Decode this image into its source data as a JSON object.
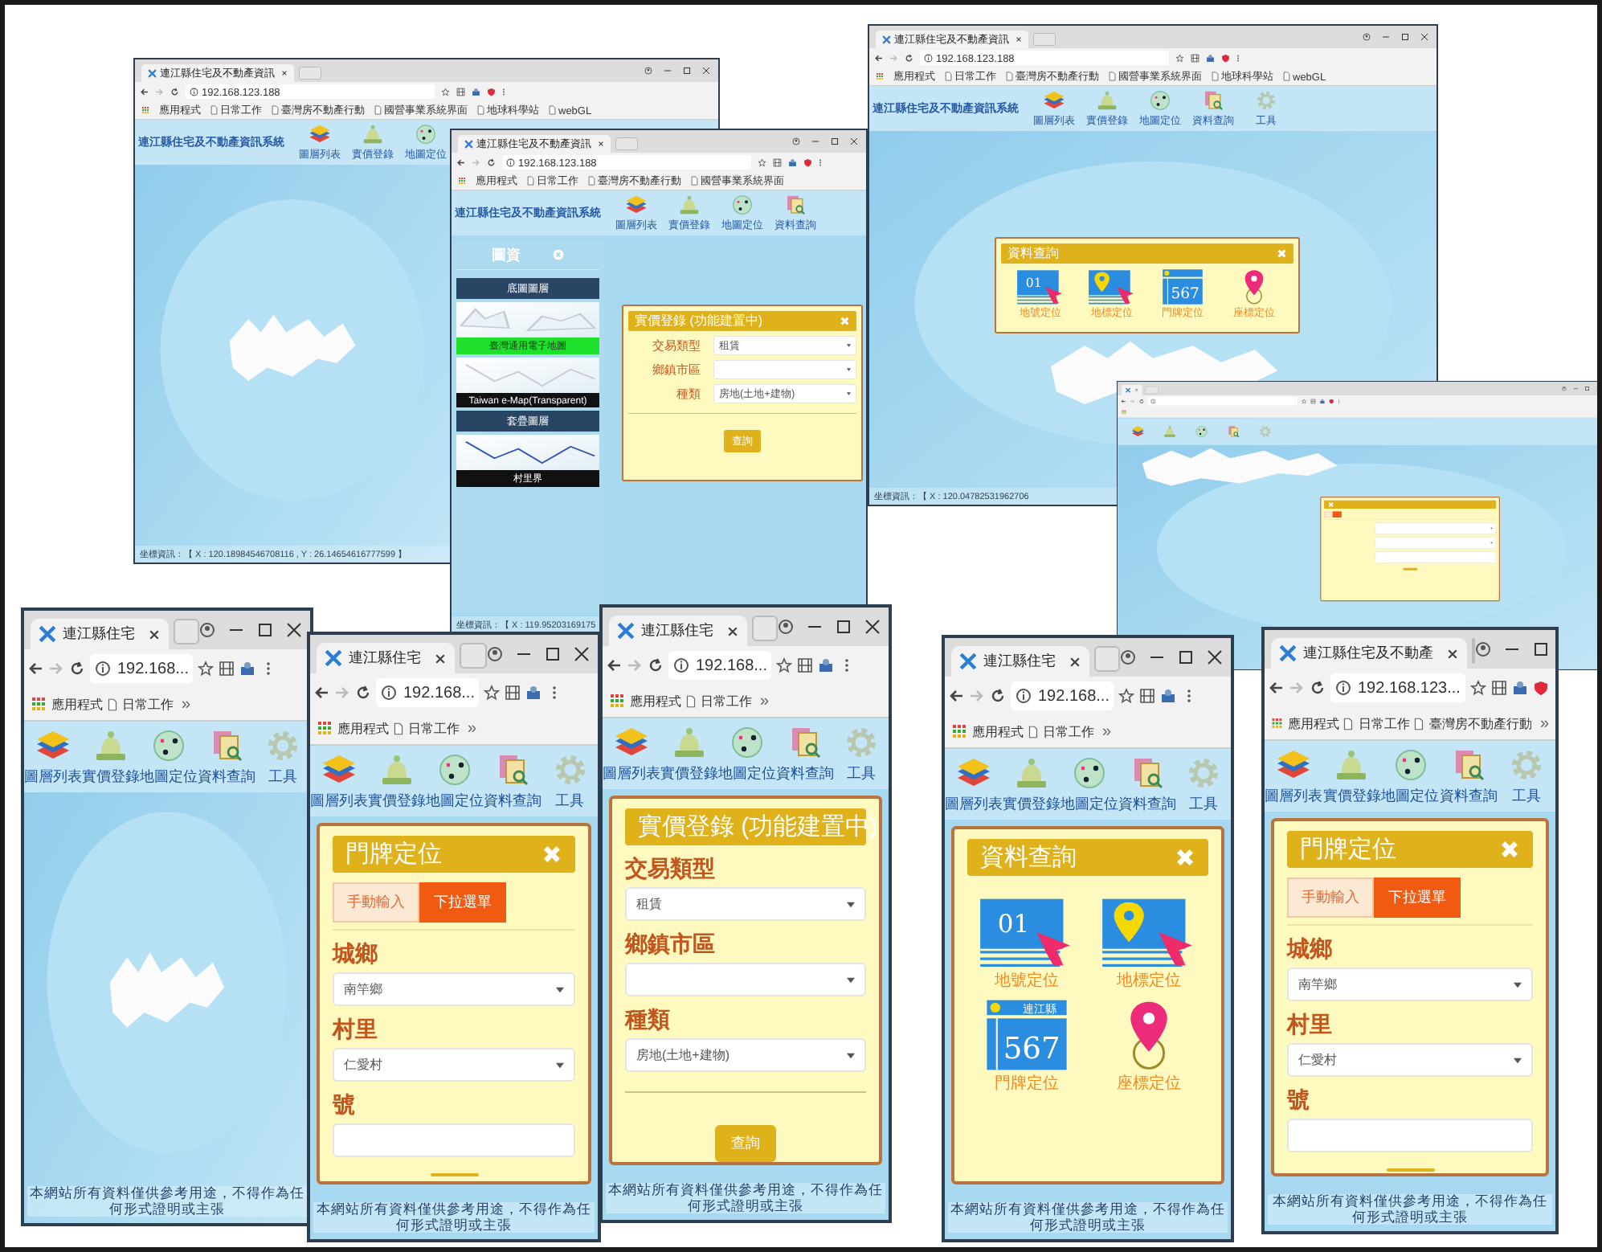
{
  "windows": [
    {
      "kind": "desktop",
      "tab_title": "連江縣住宅及不動產資訊",
      "url": "192.168.123.188",
      "bookmarks": [
        "應用程式",
        "日常工作",
        "臺灣房不動產行動",
        "國營事業系統界面",
        "地球科學站",
        "webGL"
      ],
      "app_title": "連江縣住宅及不動產資訊系統",
      "nav": [
        {
          "label": "圖層列表",
          "kind": "layers"
        },
        {
          "label": "實價登錄",
          "kind": "bell"
        },
        {
          "label": "地圖定位",
          "kind": "globe"
        }
      ],
      "status": "坐標資訊：【 X : 120.18984546708116 , Y : 26.14654616777599 】"
    },
    {
      "kind": "desktop",
      "tab_title": "連江縣住宅及不動產資訊",
      "url": "192.168.123.188",
      "bookmarks": [
        "應用程式",
        "日常工作",
        "臺灣房不動產行動",
        "國營事業系統界面"
      ],
      "app_title": "連江縣住宅及不動產資訊系統",
      "nav": [
        {
          "label": "圖層列表",
          "kind": "layers"
        },
        {
          "label": "實價登錄",
          "kind": "bell"
        },
        {
          "label": "地圖定位",
          "kind": "globe"
        },
        {
          "label": "資料查詢",
          "kind": "docs"
        }
      ],
      "sidebar": {
        "title": "圖資",
        "sections": [
          {
            "heading": "底圖圖層",
            "layers": [
              {
                "label": "臺灣通用電子地圖",
                "selected": true
              },
              {
                "label": "Taiwan e-Map(Transparent)",
                "selected": false
              }
            ]
          },
          {
            "heading": "套疊圖層",
            "layers": [
              {
                "label": "村里界",
                "selected": false
              }
            ]
          }
        ]
      },
      "dialog": {
        "kind": "price",
        "title": "實價登錄 (功能建置中)",
        "fields": [
          {
            "label": "交易類型",
            "kind": "select",
            "value": "租賃"
          },
          {
            "label": "鄉鎮市區",
            "kind": "select"
          },
          {
            "label": "種類",
            "kind": "select",
            "value": "房地(土地+建物)"
          }
        ],
        "button": "查詢"
      },
      "status": "坐標資訊：【 X : 119.95203169175"
    },
    {
      "kind": "desktop",
      "tab_title": "連江縣住宅及不動產資訊",
      "url": "192.168.123.188",
      "bookmarks": [
        "應用程式",
        "日常工作",
        "臺灣房不動產行動",
        "國營事業系統界面",
        "地球科學站",
        "webGL"
      ],
      "app_title": "連江縣住宅及不動產資訊系統",
      "nav": [
        {
          "label": "圖層列表",
          "kind": "layers"
        },
        {
          "label": "實價登錄",
          "kind": "bell"
        },
        {
          "label": "地圖定位",
          "kind": "globe"
        },
        {
          "label": "資料查詢",
          "kind": "docs"
        },
        {
          "label": "工具",
          "kind": "gear"
        }
      ],
      "dialog": {
        "kind": "query",
        "title": "資料查詢",
        "tiles": [
          {
            "label": "地號定位",
            "kind": "number",
            "number": "01"
          },
          {
            "label": "地標定位",
            "kind": "pin_card"
          },
          {
            "label": "門牌定位",
            "kind": "plate",
            "number": "567"
          },
          {
            "label": "座標定位",
            "kind": "pin"
          }
        ]
      },
      "status": "坐標資訊：【 X : 120.04782531962706"
    },
    {
      "kind": "desktop",
      "nav": [
        {
          "kind": "layers"
        },
        {
          "kind": "bell"
        },
        {
          "kind": "globe"
        },
        {
          "kind": "docs"
        },
        {
          "kind": "gear"
        }
      ],
      "dialog": {
        "kind": "door_plate",
        "tabs": [
          {
            "selected": false
          },
          {
            "selected": true
          }
        ],
        "fields": [
          {
            "kind": "select"
          },
          {
            "kind": "select"
          },
          {
            "kind": "text"
          }
        ]
      }
    },
    {
      "kind": "phone",
      "tab_title": "連江縣住宅",
      "url": "192.168...",
      "bookmarks": [
        "應用程式",
        "日常工作"
      ],
      "more": "»",
      "nav": [
        {
          "label": "圖層列表",
          "kind": "layers"
        },
        {
          "label": "實價登錄",
          "kind": "bell"
        },
        {
          "label": "地圖定位",
          "kind": "globe"
        },
        {
          "label": "資料查詢",
          "kind": "docs"
        },
        {
          "label": "工具",
          "kind": "gear"
        }
      ],
      "footer": "本網站所有資料僅供參考用途，不得作為任何形式證明或主張"
    },
    {
      "kind": "phone",
      "tab_title": "連江縣住宅",
      "url": "192.168...",
      "bookmarks": [
        "應用程式",
        "日常工作"
      ],
      "more": "»",
      "nav": [
        {
          "label": "圖層列表",
          "kind": "layers"
        },
        {
          "label": "實價登錄",
          "kind": "bell"
        },
        {
          "label": "地圖定位",
          "kind": "globe"
        },
        {
          "label": "資料查詢",
          "kind": "docs"
        },
        {
          "label": "工具",
          "kind": "gear"
        }
      ],
      "dialog": {
        "kind": "door_plate",
        "title": "門牌定位",
        "tabs": [
          {
            "label": "手動輸入",
            "selected": false
          },
          {
            "label": "下拉選單",
            "selected": true
          }
        ],
        "fields": [
          {
            "label": "城鄉",
            "kind": "select",
            "value": "南竿鄉"
          },
          {
            "label": "村里",
            "kind": "select",
            "value": "仁愛村"
          },
          {
            "label": "號",
            "kind": "text"
          }
        ]
      },
      "footer": "本網站所有資料僅供參考用途，不得作為任何形式證明或主張"
    },
    {
      "kind": "phone",
      "tab_title": "連江縣住宅",
      "url": "192.168...",
      "bookmarks": [
        "應用程式",
        "日常工作"
      ],
      "more": "»",
      "nav": [
        {
          "label": "圖層列表",
          "kind": "layers"
        },
        {
          "label": "實價登錄",
          "kind": "bell"
        },
        {
          "label": "地圖定位",
          "kind": "globe"
        },
        {
          "label": "資料查詢",
          "kind": "docs"
        },
        {
          "label": "工具",
          "kind": "gear"
        }
      ],
      "dialog": {
        "kind": "price",
        "title": "實價登錄 (功能建置中)",
        "fields": [
          {
            "label": "交易類型",
            "kind": "select",
            "value": "租賃"
          },
          {
            "label": "鄉鎮市區",
            "kind": "select"
          },
          {
            "label": "種類",
            "kind": "select",
            "value": "房地(土地+建物)"
          }
        ],
        "button": "查詢"
      },
      "footer": "本網站所有資料僅供參考用途，不得作為任何形式證明或主張"
    },
    {
      "kind": "phone",
      "tab_title": "連江縣住宅",
      "url": "192.168...",
      "bookmarks": [
        "應用程式",
        "日常工作"
      ],
      "more": "»",
      "nav": [
        {
          "label": "圖層列表",
          "kind": "layers"
        },
        {
          "label": "實價登錄",
          "kind": "bell"
        },
        {
          "label": "地圖定位",
          "kind": "globe"
        },
        {
          "label": "資料查詢",
          "kind": "docs"
        },
        {
          "label": "工具",
          "kind": "gear"
        }
      ],
      "dialog": {
        "kind": "query",
        "title": "資料查詢",
        "tiles": [
          {
            "label": "地號定位",
            "kind": "number",
            "number": "01"
          },
          {
            "label": "地標定位",
            "kind": "pin_card"
          },
          {
            "label": "門牌定位",
            "kind": "plate",
            "caption": "連江縣",
            "number": "567"
          },
          {
            "label": "座標定位",
            "kind": "pin"
          }
        ]
      },
      "footer": "本網站所有資料僅供參考用途，不得作為任何形式證明或主張"
    },
    {
      "kind": "phone",
      "tab_title": "連江縣住宅及不動產",
      "url": "192.168.123...",
      "bookmarks": [
        "應用程式",
        "日常工作",
        "臺灣房不動產行動"
      ],
      "more": "»",
      "nav": [
        {
          "label": "圖層列表",
          "kind": "layers"
        },
        {
          "label": "實價登錄",
          "kind": "bell"
        },
        {
          "label": "地圖定位",
          "kind": "globe"
        },
        {
          "label": "資料查詢",
          "kind": "docs"
        },
        {
          "label": "工具",
          "kind": "gear"
        }
      ],
      "dialog": {
        "kind": "door_plate",
        "title": "門牌定位",
        "tabs": [
          {
            "label": "手動輸入",
            "selected": false
          },
          {
            "label": "下拉選單",
            "selected": true
          }
        ],
        "fields": [
          {
            "label": "城鄉",
            "kind": "select",
            "value": "南竿鄉"
          },
          {
            "label": "村里",
            "kind": "select",
            "value": "仁愛村"
          },
          {
            "label": "號",
            "kind": "text"
          }
        ]
      },
      "footer": "本網站所有資料僅供參考用途，不得作為任何形式證明或主張"
    }
  ]
}
